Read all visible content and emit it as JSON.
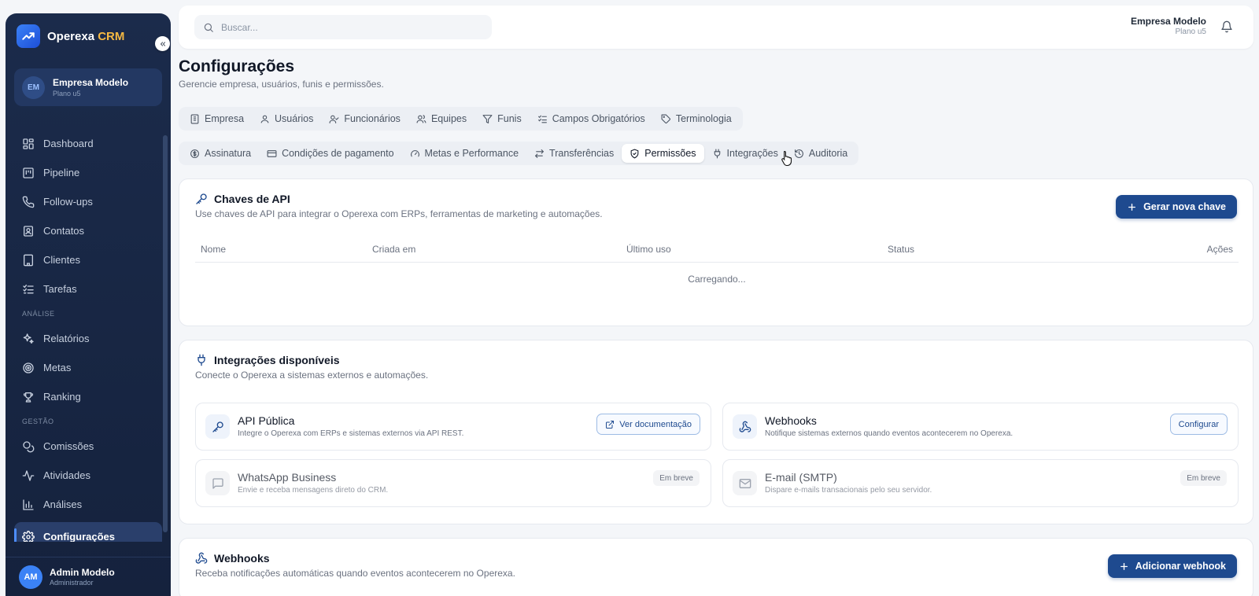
{
  "colors": {
    "sidebar_bg": "#1b2b4b",
    "accent": "#1e4a8f",
    "brand_highlight": "#f5b942",
    "page_bg": "#f4f6f9"
  },
  "brand": {
    "name": "Operexa",
    "suffix": "CRM"
  },
  "company_card": {
    "initials": "EM",
    "name": "Empresa Modelo",
    "plan": "Plano u5"
  },
  "sidebar": {
    "items": [
      {
        "label": "Dashboard",
        "icon": "dashboard-icon"
      },
      {
        "label": "Pipeline",
        "icon": "pipeline-icon"
      },
      {
        "label": "Follow-ups",
        "icon": "phone-icon"
      },
      {
        "label": "Contatos",
        "icon": "contacts-icon"
      },
      {
        "label": "Clientes",
        "icon": "building-icon"
      },
      {
        "label": "Tarefas",
        "icon": "tasks-icon"
      }
    ],
    "section_analysis": "ANÁLISE",
    "analysis_items": [
      {
        "label": "Relatórios",
        "icon": "sparkles-icon"
      },
      {
        "label": "Metas",
        "icon": "target-icon"
      },
      {
        "label": "Ranking",
        "icon": "trophy-icon"
      }
    ],
    "section_management": "GESTÃO",
    "management_items": [
      {
        "label": "Comissões",
        "icon": "coins-icon"
      },
      {
        "label": "Atividades",
        "icon": "activity-icon"
      },
      {
        "label": "Análises",
        "icon": "bar-chart-icon"
      },
      {
        "label": "Configurações",
        "icon": "gear-icon",
        "active": true
      }
    ]
  },
  "user": {
    "initials": "AM",
    "name": "Admin Modelo",
    "role": "Administrador"
  },
  "search": {
    "placeholder": "Buscar..."
  },
  "topbar": {
    "company_name": "Empresa Modelo",
    "company_plan": "Plano u5"
  },
  "page": {
    "title": "Configurações",
    "subtitle": "Gerencie empresa, usuários, funis e permissões."
  },
  "tabs_row1": [
    {
      "label": "Empresa",
      "icon": "building-icon"
    },
    {
      "label": "Usuários",
      "icon": "user-icon"
    },
    {
      "label": "Funcionários",
      "icon": "user-check-icon"
    },
    {
      "label": "Equipes",
      "icon": "users-icon"
    },
    {
      "label": "Funis",
      "icon": "filter-icon"
    },
    {
      "label": "Campos Obrigatórios",
      "icon": "list-check-icon"
    },
    {
      "label": "Terminologia",
      "icon": "tag-icon"
    }
  ],
  "tabs_row2": [
    {
      "label": "Assinatura",
      "icon": "dollar-circle-icon"
    },
    {
      "label": "Condições de pagamento",
      "icon": "credit-card-icon"
    },
    {
      "label": "Metas e Performance",
      "icon": "gauge-icon"
    },
    {
      "label": "Transferências",
      "icon": "transfer-icon"
    },
    {
      "label": "Permissões",
      "icon": "shield-check-icon",
      "active": true
    },
    {
      "label": "Integrações",
      "icon": "plug-icon"
    },
    {
      "label": "Auditoria",
      "icon": "history-icon"
    }
  ],
  "api_keys": {
    "title": "Chaves de API",
    "description": "Use chaves de API para integrar o Operexa com ERPs, ferramentas de marketing e automações.",
    "new_button": "Gerar nova chave",
    "columns": [
      "Nome",
      "Criada em",
      "Último uso",
      "Status",
      "Ações"
    ],
    "loading": "Carregando..."
  },
  "integrations": {
    "title": "Integrações disponíveis",
    "description": "Conecte o Operexa a sistemas externos e automações.",
    "items": [
      {
        "name": "API Pública",
        "description": "Integre o Operexa com ERPs e sistemas externos via API REST.",
        "action": "Ver documentação",
        "icon": "key-icon"
      },
      {
        "name": "Webhooks",
        "description": "Notifique sistemas externos quando eventos acontecerem no Operexa.",
        "action": "Configurar",
        "icon": "webhook-icon"
      },
      {
        "name": "WhatsApp Business",
        "description": "Envie e receba mensagens direto do CRM.",
        "badge": "Em breve",
        "icon": "message-icon"
      },
      {
        "name": "E-mail (SMTP)",
        "description": "Dispare e-mails transacionais pelo seu servidor.",
        "badge": "Em breve",
        "icon": "mail-icon"
      }
    ]
  },
  "webhooks": {
    "title": "Webhooks",
    "description": "Receba notificações automáticas quando eventos acontecerem no Operexa.",
    "add_button": "Adicionar webhook"
  }
}
